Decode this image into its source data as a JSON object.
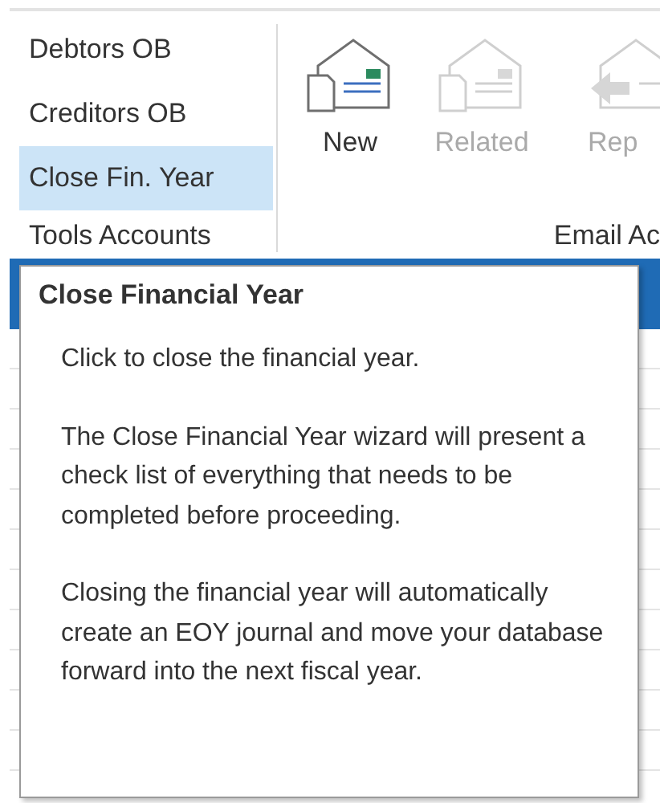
{
  "ribbon": {
    "groups": [
      {
        "label": "Tools Accounts",
        "items": [
          {
            "label": "Debtors OB",
            "selected": false
          },
          {
            "label": "Creditors OB",
            "selected": false
          },
          {
            "label": "Close Fin. Year",
            "selected": true
          }
        ]
      },
      {
        "label": "Email Ac",
        "buttons": [
          {
            "label": "New",
            "kind": "mail",
            "disabled": false
          },
          {
            "label": "Related",
            "kind": "mail",
            "disabled": true
          },
          {
            "label": "Rep",
            "kind": "reply",
            "disabled": true
          }
        ]
      }
    ]
  },
  "tooltip": {
    "title": "Close Financial Year",
    "paragraphs": [
      "Click to close the financial year.",
      "The Close Financial Year wizard will present a check list of everything that needs to be completed before proceeding.",
      "Closing the financial year will automatically create an EOY journal and move your database forward into the next fiscal year."
    ]
  }
}
